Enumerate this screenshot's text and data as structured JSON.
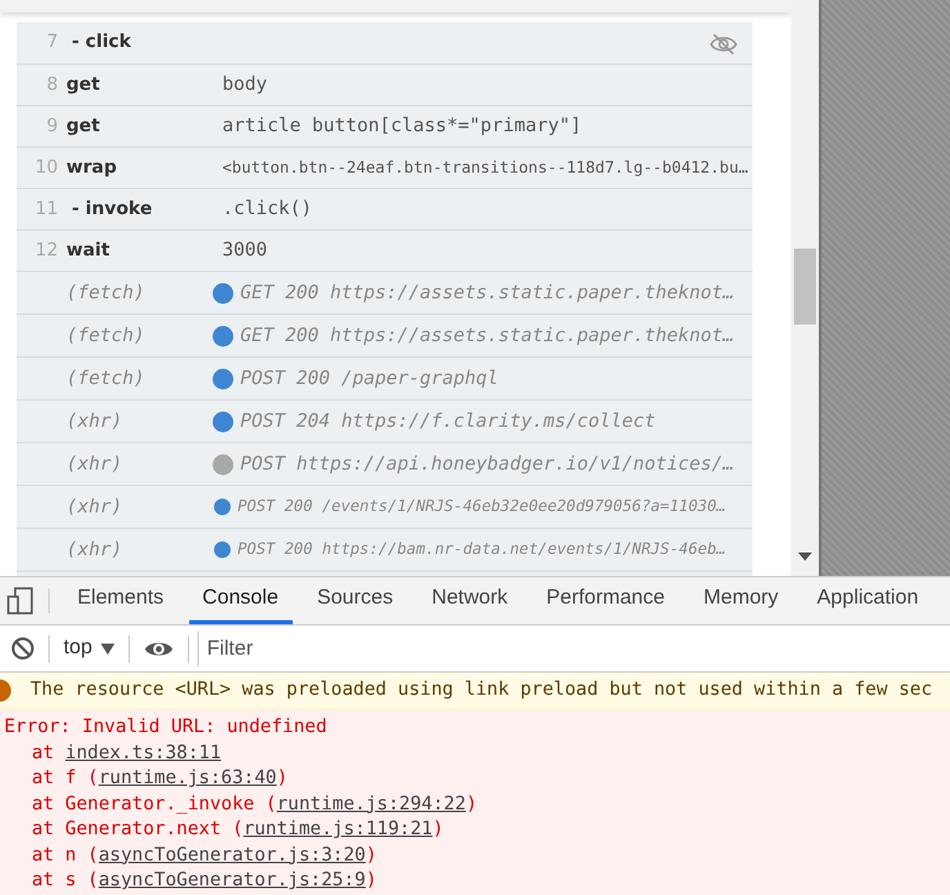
{
  "command_log": {
    "rows": [
      {
        "kind": "command",
        "number": "7",
        "name": "- click",
        "child": true,
        "hidden": true
      },
      {
        "kind": "command",
        "number": "8",
        "name": "get",
        "message": "body",
        "child": false,
        "hidden": false
      },
      {
        "kind": "command",
        "number": "9",
        "name": "get",
        "message": "article button[class*=\"primary\"]",
        "child": false,
        "hidden": false
      },
      {
        "kind": "command_small",
        "number": "10",
        "name": "wrap",
        "message": "<button.btn--24eaf.btn-transitions--118d7.lg--b0412.bu…",
        "child": false,
        "hidden": false
      },
      {
        "kind": "command",
        "number": "11",
        "name": "- invoke",
        "message": ".click()",
        "child": true,
        "hidden": false
      },
      {
        "kind": "command",
        "number": "12",
        "name": "wait",
        "message": "3000",
        "child": false,
        "hidden": false
      },
      {
        "kind": "request",
        "name": "(fetch)",
        "message": "GET 200 https://assets.static.paper.theknot…",
        "color": "#3f86d2"
      },
      {
        "kind": "request",
        "name": "(fetch)",
        "message": "GET 200 https://assets.static.paper.theknot…",
        "color": "#3f86d2"
      },
      {
        "kind": "request",
        "name": "(fetch)",
        "message": "POST 200 /paper-graphql",
        "color": "#3f86d2"
      },
      {
        "kind": "request",
        "name": "(xhr)",
        "message": "POST 204 https://f.clarity.ms/collect",
        "color": "#3f86d2"
      },
      {
        "kind": "request",
        "name": "(xhr)",
        "message": "POST https://api.honeybadger.io/v1/notices/…",
        "color": "#a8a8a8"
      },
      {
        "kind": "request_small",
        "name": "(xhr)",
        "message": "POST 200 /events/1/NRJS-46eb32e0ee20d979056?a=11030…",
        "color": "#3f86d2"
      },
      {
        "kind": "request_small",
        "name": "(xhr)",
        "message": "POST 200 https://bam.nr-data.net/events/1/NRJS-46eb…",
        "color": "#3f86d2"
      }
    ]
  },
  "devtools": {
    "tabs": [
      {
        "label": "Elements",
        "selected": false
      },
      {
        "label": "Console",
        "selected": true
      },
      {
        "label": "Sources",
        "selected": false
      },
      {
        "label": "Network",
        "selected": false
      },
      {
        "label": "Performance",
        "selected": false
      },
      {
        "label": "Memory",
        "selected": false
      },
      {
        "label": "Application",
        "selected": false
      }
    ],
    "context": "top",
    "filter": {
      "placeholder": "Filter"
    },
    "messages": [
      {
        "kind": "warning",
        "text": "The resource <URL> was preloaded using link preload but not used within a few sec"
      },
      {
        "kind": "error",
        "text": "Error: Invalid URL: undefined",
        "frames": [
          {
            "prefix": "at ",
            "link": "index.ts:38:11"
          },
          {
            "prefix": "at f (",
            "link": "runtime.js:63:40",
            "suffix": ")"
          },
          {
            "prefix": "at Generator._invoke (",
            "link": "runtime.js:294:22",
            "suffix": ")"
          },
          {
            "prefix": "at Generator.next (",
            "link": "runtime.js:119:21",
            "suffix": ")"
          },
          {
            "prefix": "at n (",
            "link": "asyncToGenerator.js:3:20",
            "suffix": ")"
          },
          {
            "prefix": "at s (",
            "link": "asyncToGenerator.js:25:9",
            "suffix": ")"
          }
        ]
      }
    ]
  }
}
